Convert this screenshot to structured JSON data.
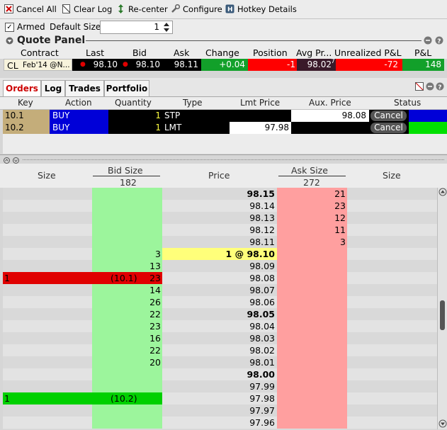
{
  "toolbar": {
    "cancel_all": "Cancel All",
    "clear_log": "Clear Log",
    "recenter": "Re-center",
    "configure": "Configure",
    "hotkey_details": "Hotkey Details"
  },
  "armed": {
    "label": "Armed",
    "checked": "✓",
    "default_size_label": "Default Size",
    "default_size_value": "1"
  },
  "quote_panel": {
    "title": "Quote Panel",
    "columns": [
      "Contract",
      "Last",
      "Bid",
      "Ask",
      "Change",
      "Position",
      "Avg Pr...",
      "Unrealized P&L",
      "P&L"
    ],
    "row": {
      "contract": "CL",
      "contract_detail": "Feb'14 @N...",
      "last": "98.10",
      "bid": "98.10",
      "ask": "98.11",
      "change": "+0.04",
      "position": "-1",
      "avg_price": "98.02",
      "avg_price_sup": "7",
      "unrealized_pnl": "-72",
      "pnl": "148"
    }
  },
  "tabs": [
    "Orders",
    "Log",
    "Trades",
    "Portfolio"
  ],
  "orders": {
    "columns": [
      "Key",
      "Action",
      "Quantity",
      "Type",
      "Lmt Price",
      "Aux. Price",
      "Status"
    ],
    "rows": [
      {
        "key": "10.1",
        "action": "BUY",
        "quantity": "1",
        "type": "STP",
        "lmt_price": "",
        "aux_price": "98.08",
        "cancel": "Cancel",
        "status_color": "#0000d8"
      },
      {
        "key": "10.2",
        "action": "BUY",
        "quantity": "1",
        "type": "LMT",
        "lmt_price": "97.98",
        "aux_price": "",
        "cancel": "Cancel",
        "status_color": "#00e000"
      }
    ]
  },
  "ladder": {
    "headers": {
      "size_left": "Size",
      "bid_size": "Bid Size",
      "bid_total": "182",
      "price": "Price",
      "ask_size": "Ask Size",
      "ask_total": "272",
      "size_right": "Size"
    },
    "rows": [
      {
        "price": "98.15",
        "bold": true,
        "bid": "",
        "ask": "21",
        "left": "",
        "order": ""
      },
      {
        "price": "98.14",
        "bold": false,
        "bid": "",
        "ask": "23",
        "left": "",
        "order": ""
      },
      {
        "price": "98.13",
        "bold": false,
        "bid": "",
        "ask": "12",
        "left": "",
        "order": ""
      },
      {
        "price": "98.12",
        "bold": false,
        "bid": "",
        "ask": "11",
        "left": "",
        "order": ""
      },
      {
        "price": "98.11",
        "bold": false,
        "bid": "",
        "ask": "3",
        "left": "",
        "order": ""
      },
      {
        "price": "1 @ 98.10",
        "bold": true,
        "bid": "3",
        "ask": "",
        "left": "",
        "order": "",
        "last": true
      },
      {
        "price": "98.09",
        "bold": false,
        "bid": "13",
        "ask": "",
        "left": "",
        "order": ""
      },
      {
        "price": "98.08",
        "bold": false,
        "bid": "23",
        "ask": "",
        "left": "1",
        "order": "(10.1)",
        "highlight": "red"
      },
      {
        "price": "98.07",
        "bold": false,
        "bid": "14",
        "ask": "",
        "left": "",
        "order": ""
      },
      {
        "price": "98.06",
        "bold": false,
        "bid": "26",
        "ask": "",
        "left": "",
        "order": ""
      },
      {
        "price": "98.05",
        "bold": true,
        "bid": "22",
        "ask": "",
        "left": "",
        "order": ""
      },
      {
        "price": "98.04",
        "bold": false,
        "bid": "23",
        "ask": "",
        "left": "",
        "order": ""
      },
      {
        "price": "98.03",
        "bold": false,
        "bid": "16",
        "ask": "",
        "left": "",
        "order": ""
      },
      {
        "price": "98.02",
        "bold": false,
        "bid": "22",
        "ask": "",
        "left": "",
        "order": ""
      },
      {
        "price": "98.01",
        "bold": false,
        "bid": "20",
        "ask": "",
        "left": "",
        "order": ""
      },
      {
        "price": "98.00",
        "bold": true,
        "bid": "",
        "ask": "",
        "left": "",
        "order": ""
      },
      {
        "price": "97.99",
        "bold": false,
        "bid": "",
        "ask": "",
        "left": "",
        "order": ""
      },
      {
        "price": "97.98",
        "bold": false,
        "bid": "",
        "ask": "",
        "left": "1",
        "order": "(10.2)",
        "highlight": "green"
      },
      {
        "price": "97.97",
        "bold": false,
        "bid": "",
        "ask": "",
        "left": "",
        "order": ""
      },
      {
        "price": "97.96",
        "bold": false,
        "bid": "",
        "ask": "",
        "left": "",
        "order": ""
      }
    ]
  },
  "colors": {
    "bid_col": "#9cf59c",
    "ask_col": "#ff9f9f",
    "last_price": "#ffff7a",
    "red_order": "#e00000",
    "green_order": "#00d000"
  }
}
